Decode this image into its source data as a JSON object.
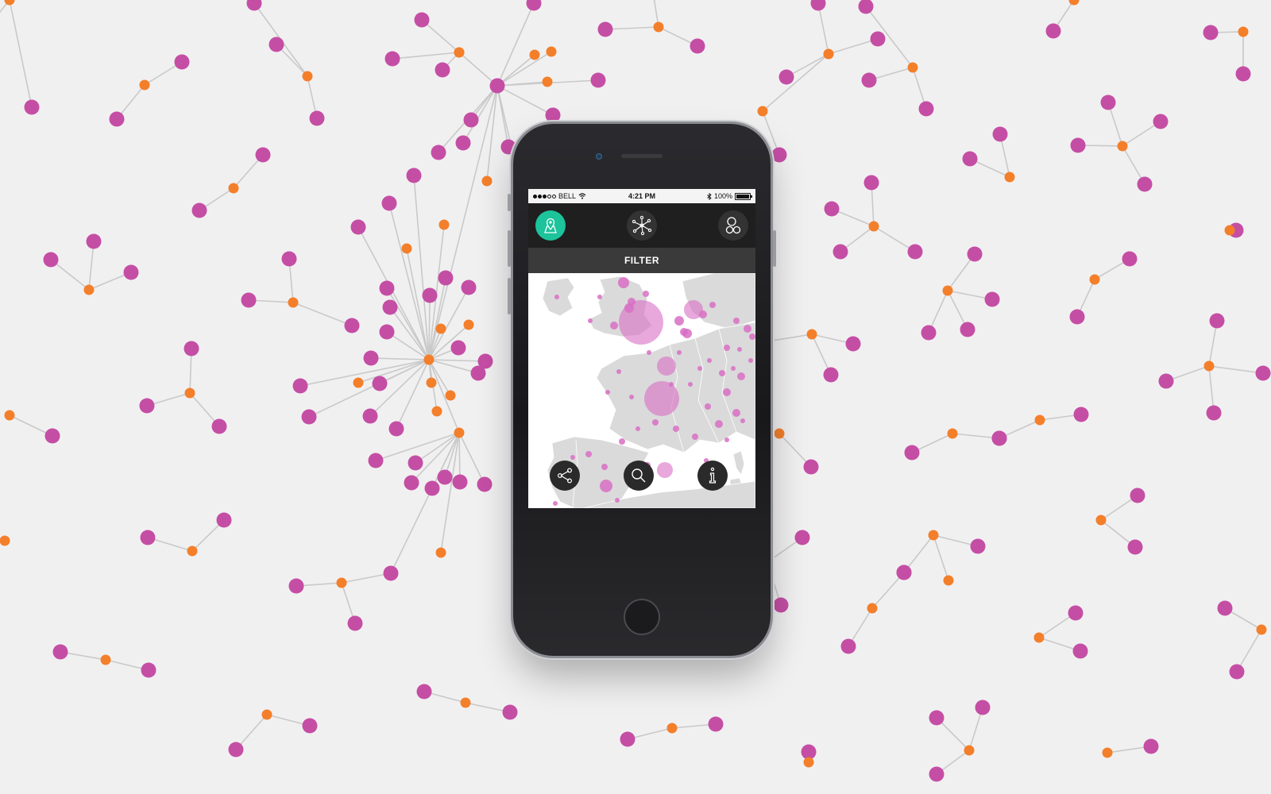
{
  "status_bar": {
    "carrier": "BELL",
    "time": "4:21 PM",
    "battery": "100%"
  },
  "nav": {
    "items": [
      {
        "icon": "map-pin-icon",
        "active": true
      },
      {
        "icon": "network-icon",
        "active": false
      },
      {
        "icon": "circles-icon",
        "active": false
      }
    ]
  },
  "filter": {
    "label": "FILTER"
  },
  "map_actions": [
    {
      "icon": "share-icon"
    },
    {
      "icon": "search-icon"
    },
    {
      "icon": "info-icon"
    }
  ],
  "colors": {
    "background": "#f1f0f1",
    "node_purple": "#c54ea5",
    "node_orange": "#f47f2a",
    "link_gray": "#c9c9c9",
    "accent_green": "#1cc39b",
    "map_land": "#dadada",
    "map_bubble": "#d86ec4"
  }
}
